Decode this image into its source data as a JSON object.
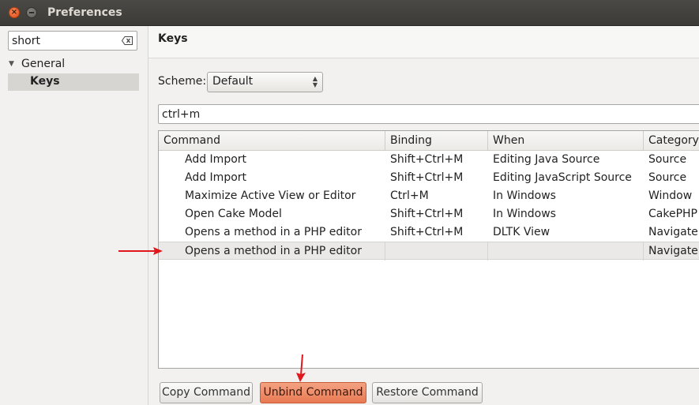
{
  "window": {
    "title": "Preferences"
  },
  "sidebar": {
    "filter_value": "short",
    "tree": {
      "group": "General",
      "selected": "Keys"
    }
  },
  "page": {
    "heading": "Keys",
    "scheme_label": "Scheme:",
    "scheme_value": "Default",
    "key_filter_value": "ctrl+m"
  },
  "table": {
    "columns": [
      "Command",
      "Binding",
      "When",
      "Category"
    ],
    "rows": [
      [
        "Add Import",
        "Shift+Ctrl+M",
        "Editing Java Source",
        "Source"
      ],
      [
        "Add Import",
        "Shift+Ctrl+M",
        "Editing JavaScript Source",
        "Source"
      ],
      [
        "Maximize Active View or Editor",
        "Ctrl+M",
        "In Windows",
        "Window"
      ],
      [
        "Open Cake Model",
        "Shift+Ctrl+M",
        "In Windows",
        "CakePHP"
      ],
      [
        "Opens a method in a PHP editor",
        "Shift+Ctrl+M",
        "DLTK View",
        "Navigate"
      ],
      [
        "Opens a method in a PHP editor",
        "",
        "",
        "Navigate"
      ]
    ],
    "selected_row": 5
  },
  "buttons": {
    "copy": "Copy Command",
    "unbind": "Unbind Command",
    "restore": "Restore Command"
  },
  "colors": {
    "annotation_arrow": "#e0181e",
    "focus_button": "#e87a53"
  }
}
